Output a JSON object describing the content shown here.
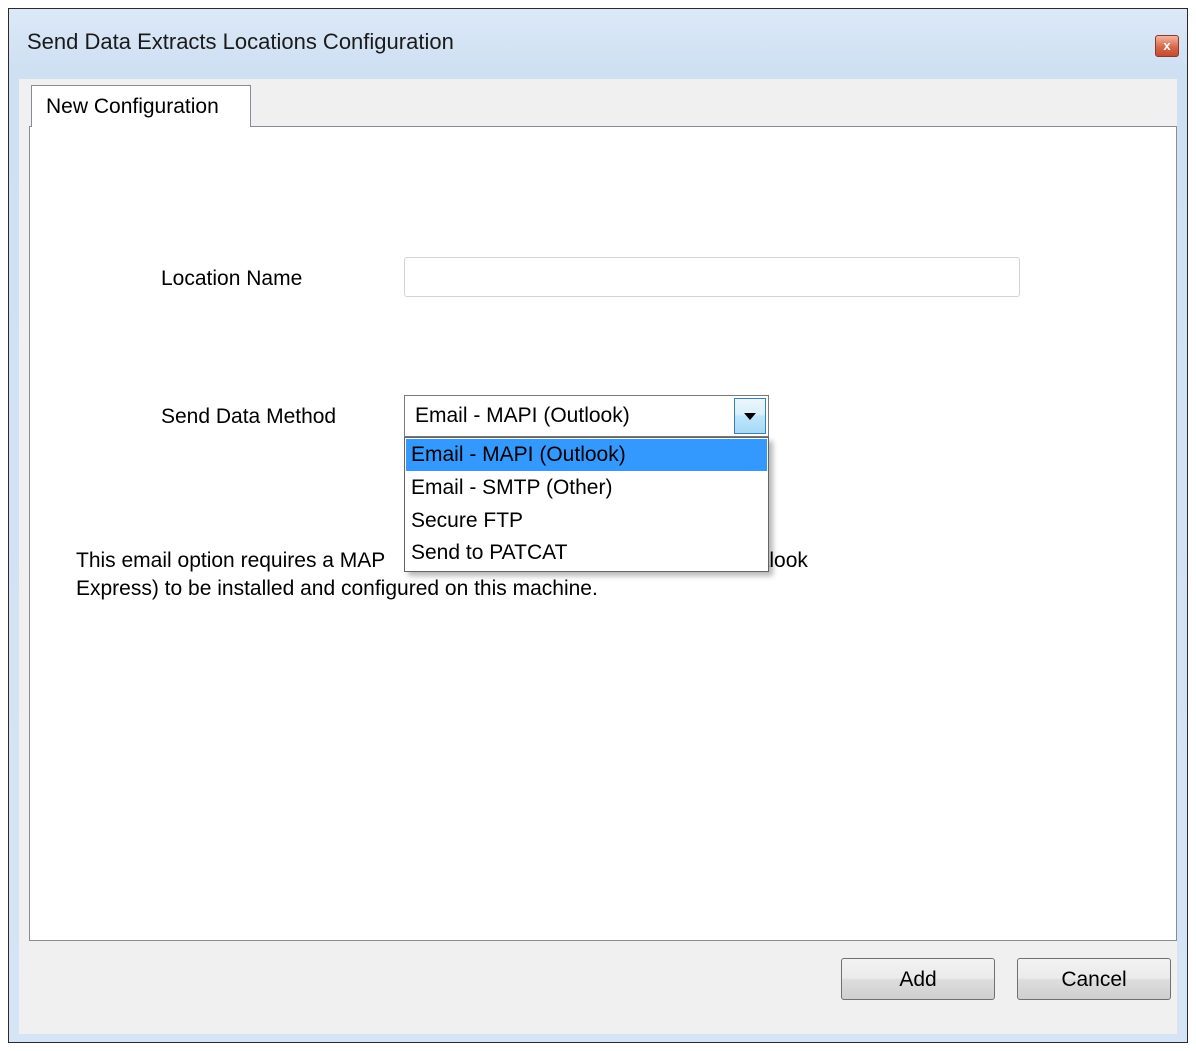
{
  "window": {
    "title": "Send Data Extracts Locations Configuration",
    "close_glyph": "x"
  },
  "tabs": [
    {
      "label": "New Configuration",
      "selected": true
    }
  ],
  "form": {
    "location_name_label": "Location Name",
    "location_name_value": "",
    "send_method_label": "Send Data Method",
    "send_method_selected": "Email - MAPI (Outlook)",
    "send_method_options": [
      "Email - MAPI (Outlook)",
      "Email - SMTP (Other)",
      "Secure FTP",
      "Send to PATCAT"
    ],
    "info_line1_left": "This email option requires a MAP",
    "info_line1_right": "icrosoft Outlook or Outlook",
    "info_line2": "Express) to be installed and configured on this machine."
  },
  "buttons": {
    "add": "Add",
    "cancel": "Cancel"
  },
  "colors": {
    "selection": "#3399ff",
    "close_button": "#d9674a"
  }
}
